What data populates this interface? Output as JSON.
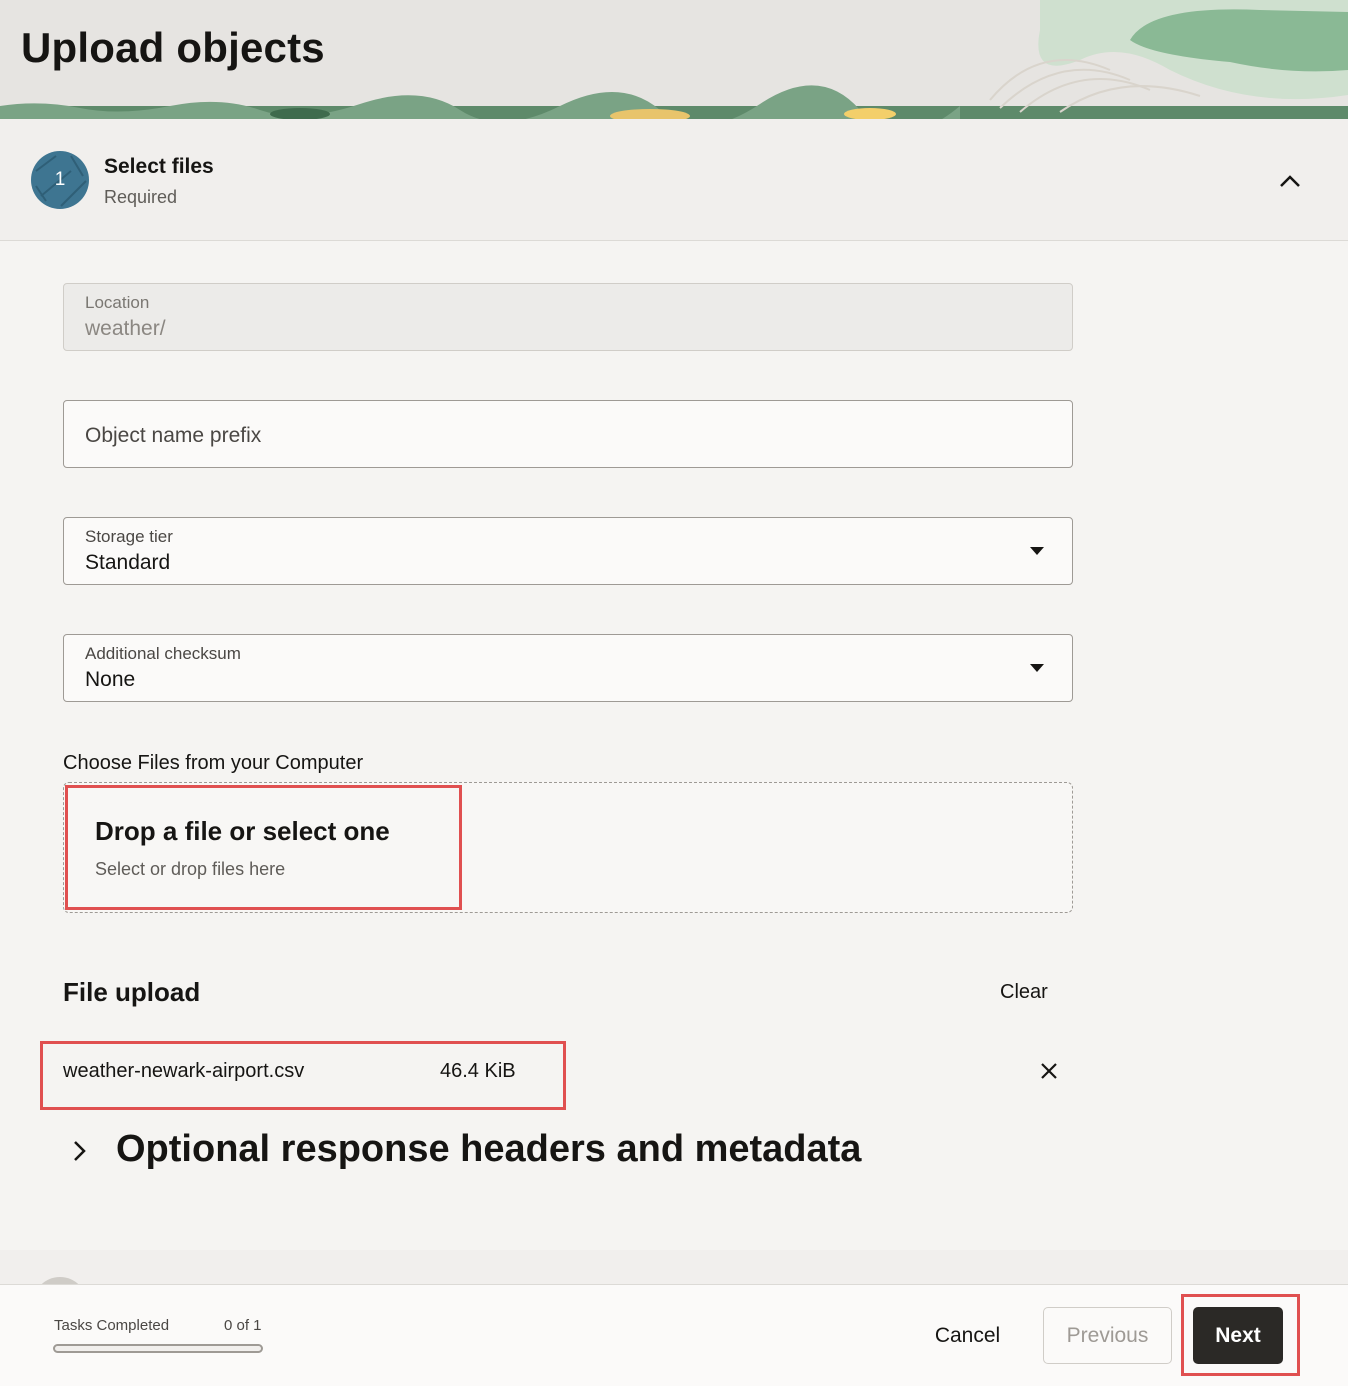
{
  "header": {
    "title": "Upload objects"
  },
  "step": {
    "number": "1",
    "title": "Select files",
    "subtitle": "Required"
  },
  "form": {
    "location": {
      "label": "Location",
      "value": "weather/"
    },
    "prefix": {
      "placeholder": "Object name prefix"
    },
    "storage_tier": {
      "label": "Storage tier",
      "value": "Standard"
    },
    "checksum": {
      "label": "Additional checksum",
      "value": "None"
    }
  },
  "chooser": {
    "label": "Choose Files from your Computer",
    "title": "Drop a file or select one",
    "subtitle": "Select or drop files here"
  },
  "uploads": {
    "title": "File upload",
    "clear_label": "Clear",
    "files": [
      {
        "name": "weather-newark-airport.csv",
        "size": "46.4 KiB"
      }
    ]
  },
  "optional": {
    "title": "Optional response headers and metadata"
  },
  "footer": {
    "tasks_label": "Tasks Completed",
    "tasks_count": "0 of 1",
    "progress_fraction": 0,
    "cancel": "Cancel",
    "previous": "Previous",
    "next": "Next"
  },
  "colors": {
    "accent": "#3e7591",
    "highlight": "#e05050",
    "primary_button": "#2b2926"
  }
}
